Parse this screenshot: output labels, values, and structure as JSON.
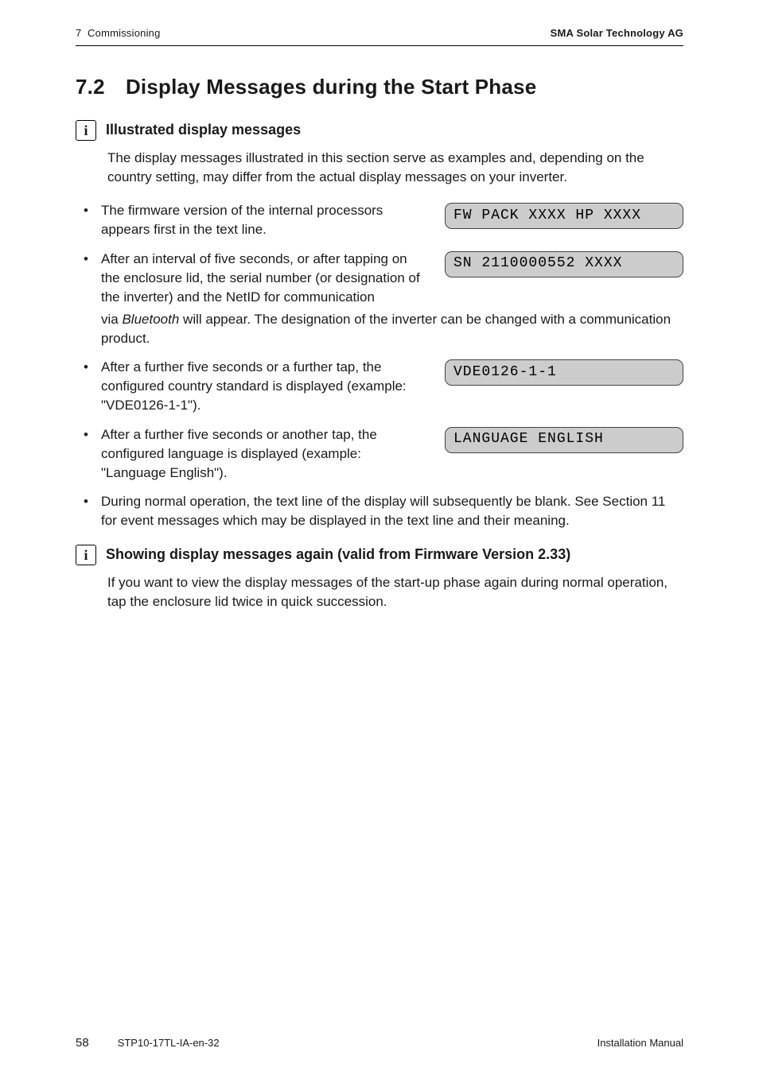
{
  "header": {
    "left": "7  Commissioning",
    "right": "SMA Solar Technology AG"
  },
  "section": {
    "number_title": "7.2 Display Messages during the Start Phase"
  },
  "info1": {
    "title": "Illustrated display messages",
    "body": "The display messages illustrated in this section serve as examples and, depending on the country setting, may differ from the actual display messages on your inverter."
  },
  "bullets": [
    {
      "text": "The firmware version of the internal processors appears first in the text line.",
      "lcd": "FW PACK xxxx HP xxxx",
      "two_col": true
    },
    {
      "text_a": "After an interval of five seconds, or after tapping on the enclosure lid, the serial number (or designation of the inverter) and the NetID for communication",
      "text_b_pre": "via ",
      "text_b_italic": "Bluetooth",
      "text_b_post": " will appear. The designation of the inverter can be changed with a communication product.",
      "lcd": "SN 2110000552 XXXX",
      "two_col_split": true
    },
    {
      "text": "After a further five seconds or a further tap, the configured country standard is displayed (example: \"VDE0126-1-1\").",
      "lcd": "VDE0126-1-1",
      "two_col": true
    },
    {
      "text": "After a further five seconds or another tap, the configured language is displayed (example: \"Language English\").",
      "lcd": "LANGUAGE ENGLISH",
      "two_col": true
    },
    {
      "text": "During normal operation, the text line of the display will subsequently be blank. See Section 11 for event messages which may be displayed in the text line and their meaning.",
      "two_col": false
    }
  ],
  "info2": {
    "title": "Showing display messages again (valid from Firmware Version 2.33)",
    "body": "If you want to view the display messages of the start-up phase again during normal operation, tap the enclosure lid twice in quick succession."
  },
  "footer": {
    "page": "58",
    "doc_id": "STP10-17TL-IA-en-32",
    "right": "Installation Manual"
  },
  "icon": {
    "info_glyph": "i"
  }
}
